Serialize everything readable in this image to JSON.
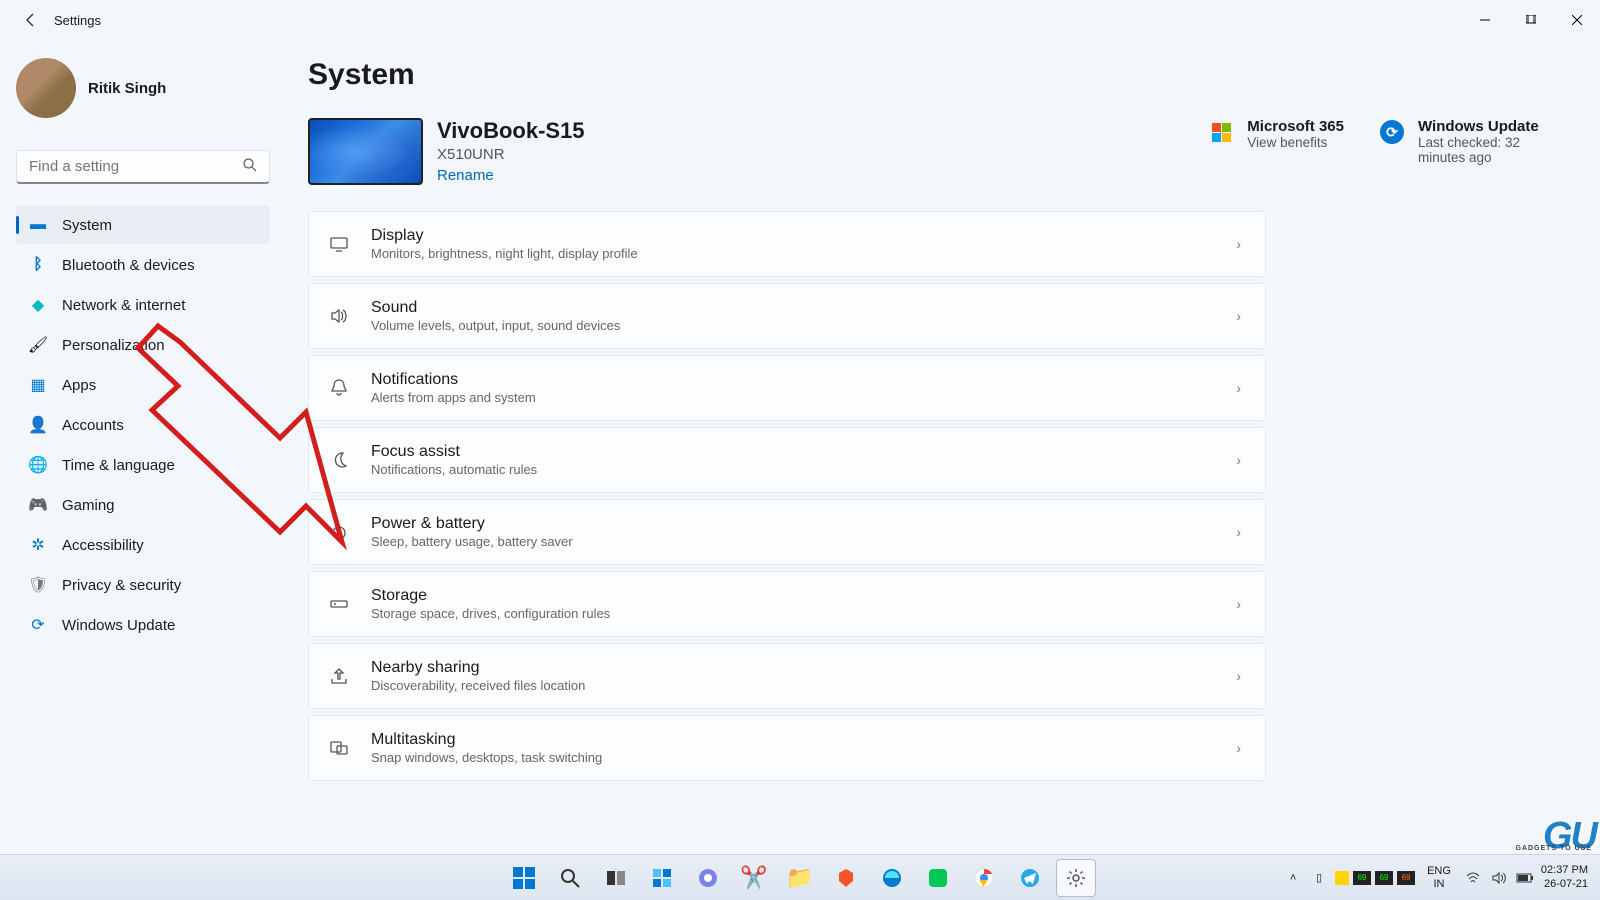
{
  "window": {
    "title": "Settings"
  },
  "user": {
    "name": "Ritik Singh"
  },
  "search": {
    "placeholder": "Find a setting"
  },
  "nav": [
    {
      "icon": "💻",
      "label": "System",
      "color": "#0078d4"
    },
    {
      "icon": "ᛒ",
      "label": "Bluetooth & devices",
      "color": "#0078d4"
    },
    {
      "icon": "◆",
      "label": "Network & internet",
      "color": "#00b7c3"
    },
    {
      "icon": "🖌",
      "label": "Personalization",
      "color": "#b4690e"
    },
    {
      "icon": "▣",
      "label": "Apps",
      "color": "#0078d4"
    },
    {
      "icon": "👤",
      "label": "Accounts",
      "color": "#0099bc"
    },
    {
      "icon": "🌐",
      "label": "Time & language",
      "color": "#0078d4"
    },
    {
      "icon": "🎮",
      "label": "Gaming",
      "color": "#767676"
    },
    {
      "icon": "✲",
      "label": "Accessibility",
      "color": "#0078d4"
    },
    {
      "icon": "🛡",
      "label": "Privacy & security",
      "color": "#767676"
    },
    {
      "icon": "⟳",
      "label": "Windows Update",
      "color": "#0078d4"
    }
  ],
  "page": {
    "title": "System"
  },
  "device": {
    "name": "VivoBook-S15",
    "model": "X510UNR",
    "rename": "Rename"
  },
  "header_cards": {
    "microsoft": {
      "title": "Microsoft 365",
      "sub": "View benefits"
    },
    "update": {
      "title": "Windows Update",
      "sub": "Last checked: 32 minutes ago"
    }
  },
  "settings": [
    {
      "icon": "display",
      "title": "Display",
      "desc": "Monitors, brightness, night light, display profile"
    },
    {
      "icon": "sound",
      "title": "Sound",
      "desc": "Volume levels, output, input, sound devices"
    },
    {
      "icon": "bell",
      "title": "Notifications",
      "desc": "Alerts from apps and system"
    },
    {
      "icon": "moon",
      "title": "Focus assist",
      "desc": "Notifications, automatic rules"
    },
    {
      "icon": "power",
      "title": "Power & battery",
      "desc": "Sleep, battery usage, battery saver"
    },
    {
      "icon": "storage",
      "title": "Storage",
      "desc": "Storage space, drives, configuration rules"
    },
    {
      "icon": "share",
      "title": "Nearby sharing",
      "desc": "Discoverability, received files location"
    },
    {
      "icon": "multitask",
      "title": "Multitasking",
      "desc": "Snap windows, desktops, task switching"
    }
  ],
  "taskbar": {
    "lang": {
      "a": "ENG",
      "b": "IN"
    },
    "clock": {
      "time": "02:37 PM",
      "date": "26-07-21"
    }
  },
  "watermark": {
    "logo": "GU",
    "sub": "GADGETS TO USE"
  }
}
